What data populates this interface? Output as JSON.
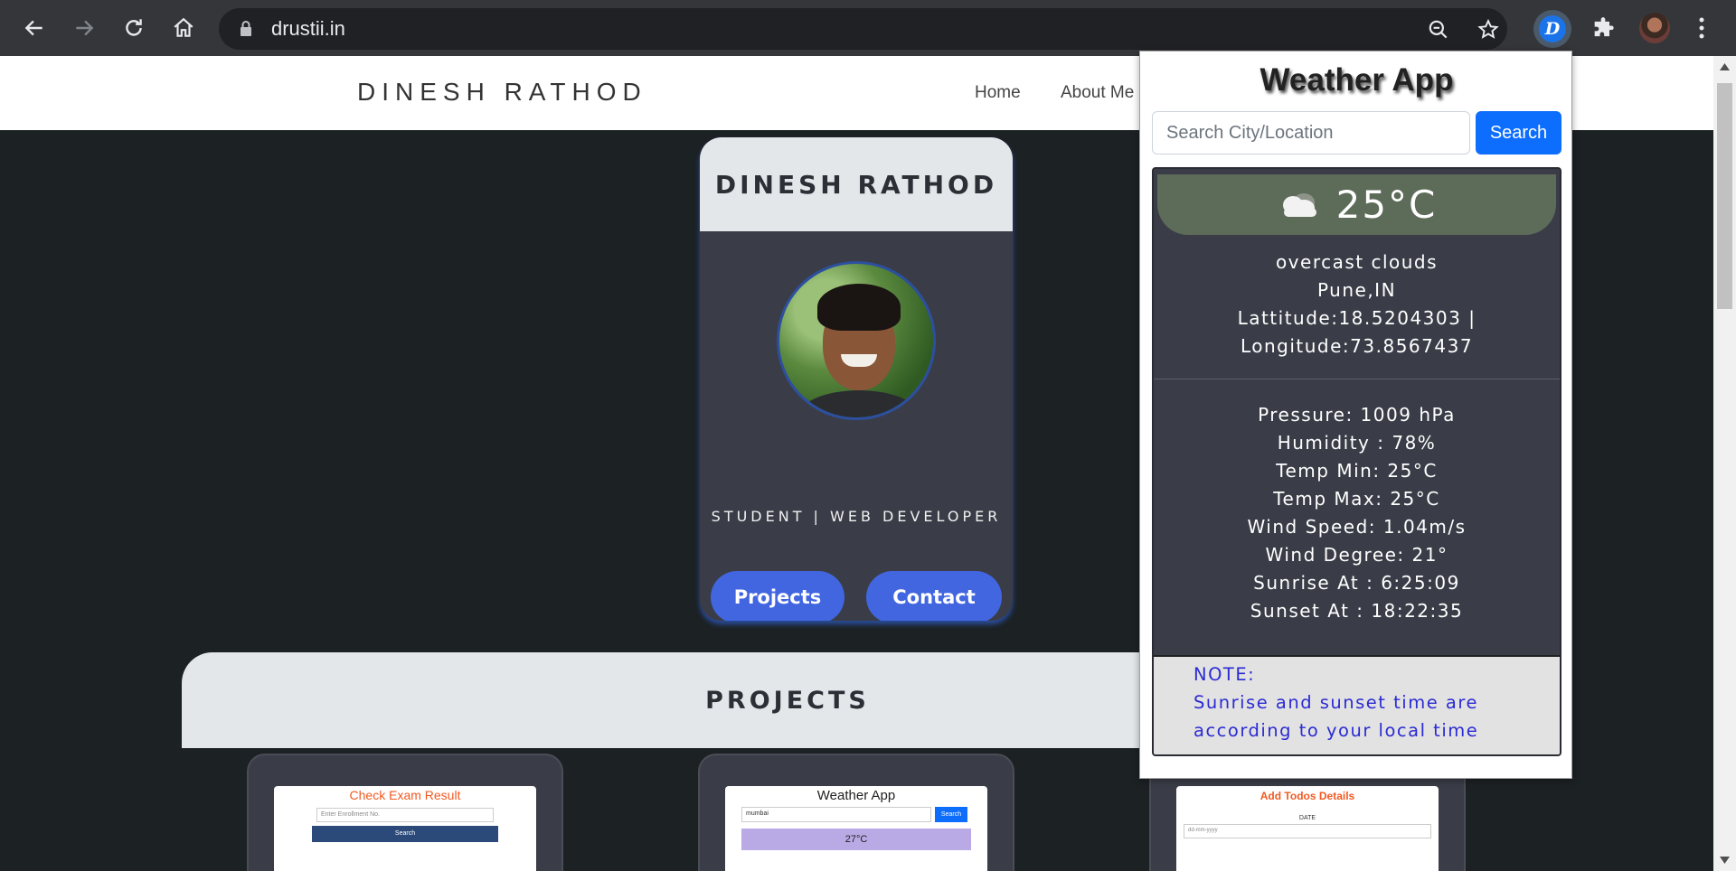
{
  "browser": {
    "url": "drustii.in",
    "extension_badge": "D"
  },
  "site": {
    "brand": "DINESH RATHOD",
    "nav": [
      "Home",
      "About Me"
    ],
    "profile": {
      "name": "DINESH RATHOD",
      "role": "STUDENT | WEB DEVELOPER",
      "buttons": [
        "Projects",
        "Contact"
      ]
    },
    "projects": {
      "title": "PROJECTS",
      "cards": [
        {
          "heading": "Check Exam Result",
          "input_placeholder": "Enter Enrollment No.",
          "button": "Search"
        },
        {
          "heading": "Weather App",
          "input_value": "mumbai",
          "button": "Search",
          "temp": "27°C"
        },
        {
          "heading": "Add Todos Details",
          "label": "DATE",
          "input_placeholder": "dd-mm-yyyy"
        }
      ]
    }
  },
  "popup": {
    "title": "Weather App",
    "search_placeholder": "Search City/Location",
    "search_button": "Search",
    "temperature": "25°C",
    "description": "overcast clouds",
    "location": "Pune,IN",
    "latitude_line": "Lattitude:18.5204303 |",
    "longitude_line": "Longitude:73.8567437",
    "details": [
      "Pressure: 1009 hPa",
      "Humidity : 78%",
      "Temp Min: 25°C",
      "Temp Max: 25°C",
      "Wind Speed: 1.04m/s",
      "Wind Degree: 21°",
      "Sunrise At : 6:25:09",
      "Sunset At : 18:22:35"
    ],
    "note_label": "NOTE:",
    "note_lines": [
      "Sunrise and sunset time are",
      "according to your local time"
    ]
  }
}
